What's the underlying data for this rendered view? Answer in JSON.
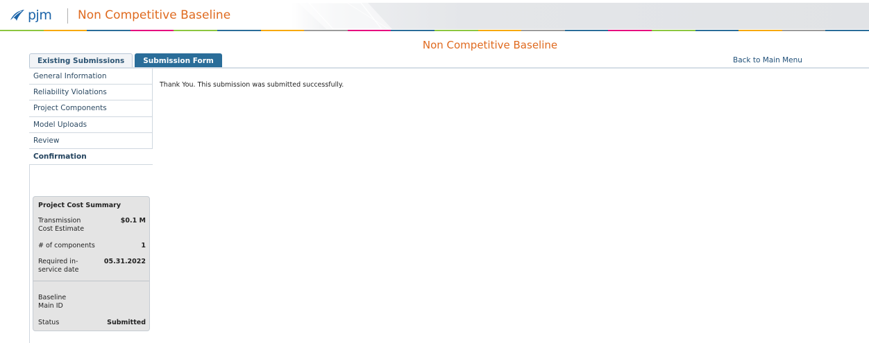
{
  "header": {
    "logo_text": "pjm",
    "app_title": "Non Competitive Baseline",
    "stripe_colors": [
      "#8cc63f",
      "#f7a800",
      "#2a6d99",
      "#e6007e",
      "#8cc63f",
      "#2a6d99",
      "#f7a800",
      "#9b9b9b",
      "#e6007e",
      "#2a6d99",
      "#8cc63f",
      "#f7a800",
      "#9b9b9b",
      "#2a6d99",
      "#e6007e",
      "#8cc63f",
      "#2a6d99",
      "#f7a800",
      "#9b9b9b",
      "#2a6d99"
    ],
    "accent_color": "#df6a1f"
  },
  "page": {
    "title": "Non Competitive Baseline"
  },
  "tabs": [
    {
      "label": "Existing Submissions",
      "active": false
    },
    {
      "label": "Submission Form",
      "active": true
    }
  ],
  "back_link": "Back to Main Menu",
  "nav": [
    {
      "label": "General Information"
    },
    {
      "label": "Reliability Violations"
    },
    {
      "label": "Project Components"
    },
    {
      "label": "Model Uploads"
    },
    {
      "label": "Review"
    },
    {
      "label": "Confirmation",
      "current": true
    }
  ],
  "message": "Thank You. This submission was submitted successfully.",
  "summary": {
    "title": "Project Cost Summary",
    "rows": [
      {
        "label": "Transmission Cost Estimate",
        "value": "$0.1 M"
      },
      {
        "label": "# of components",
        "value": "1"
      },
      {
        "label": "Required in-service date",
        "value": "05.31.2022"
      },
      {
        "label": "Baseline Main ID",
        "value": ""
      },
      {
        "label": "Status",
        "value": "Submitted"
      }
    ]
  }
}
